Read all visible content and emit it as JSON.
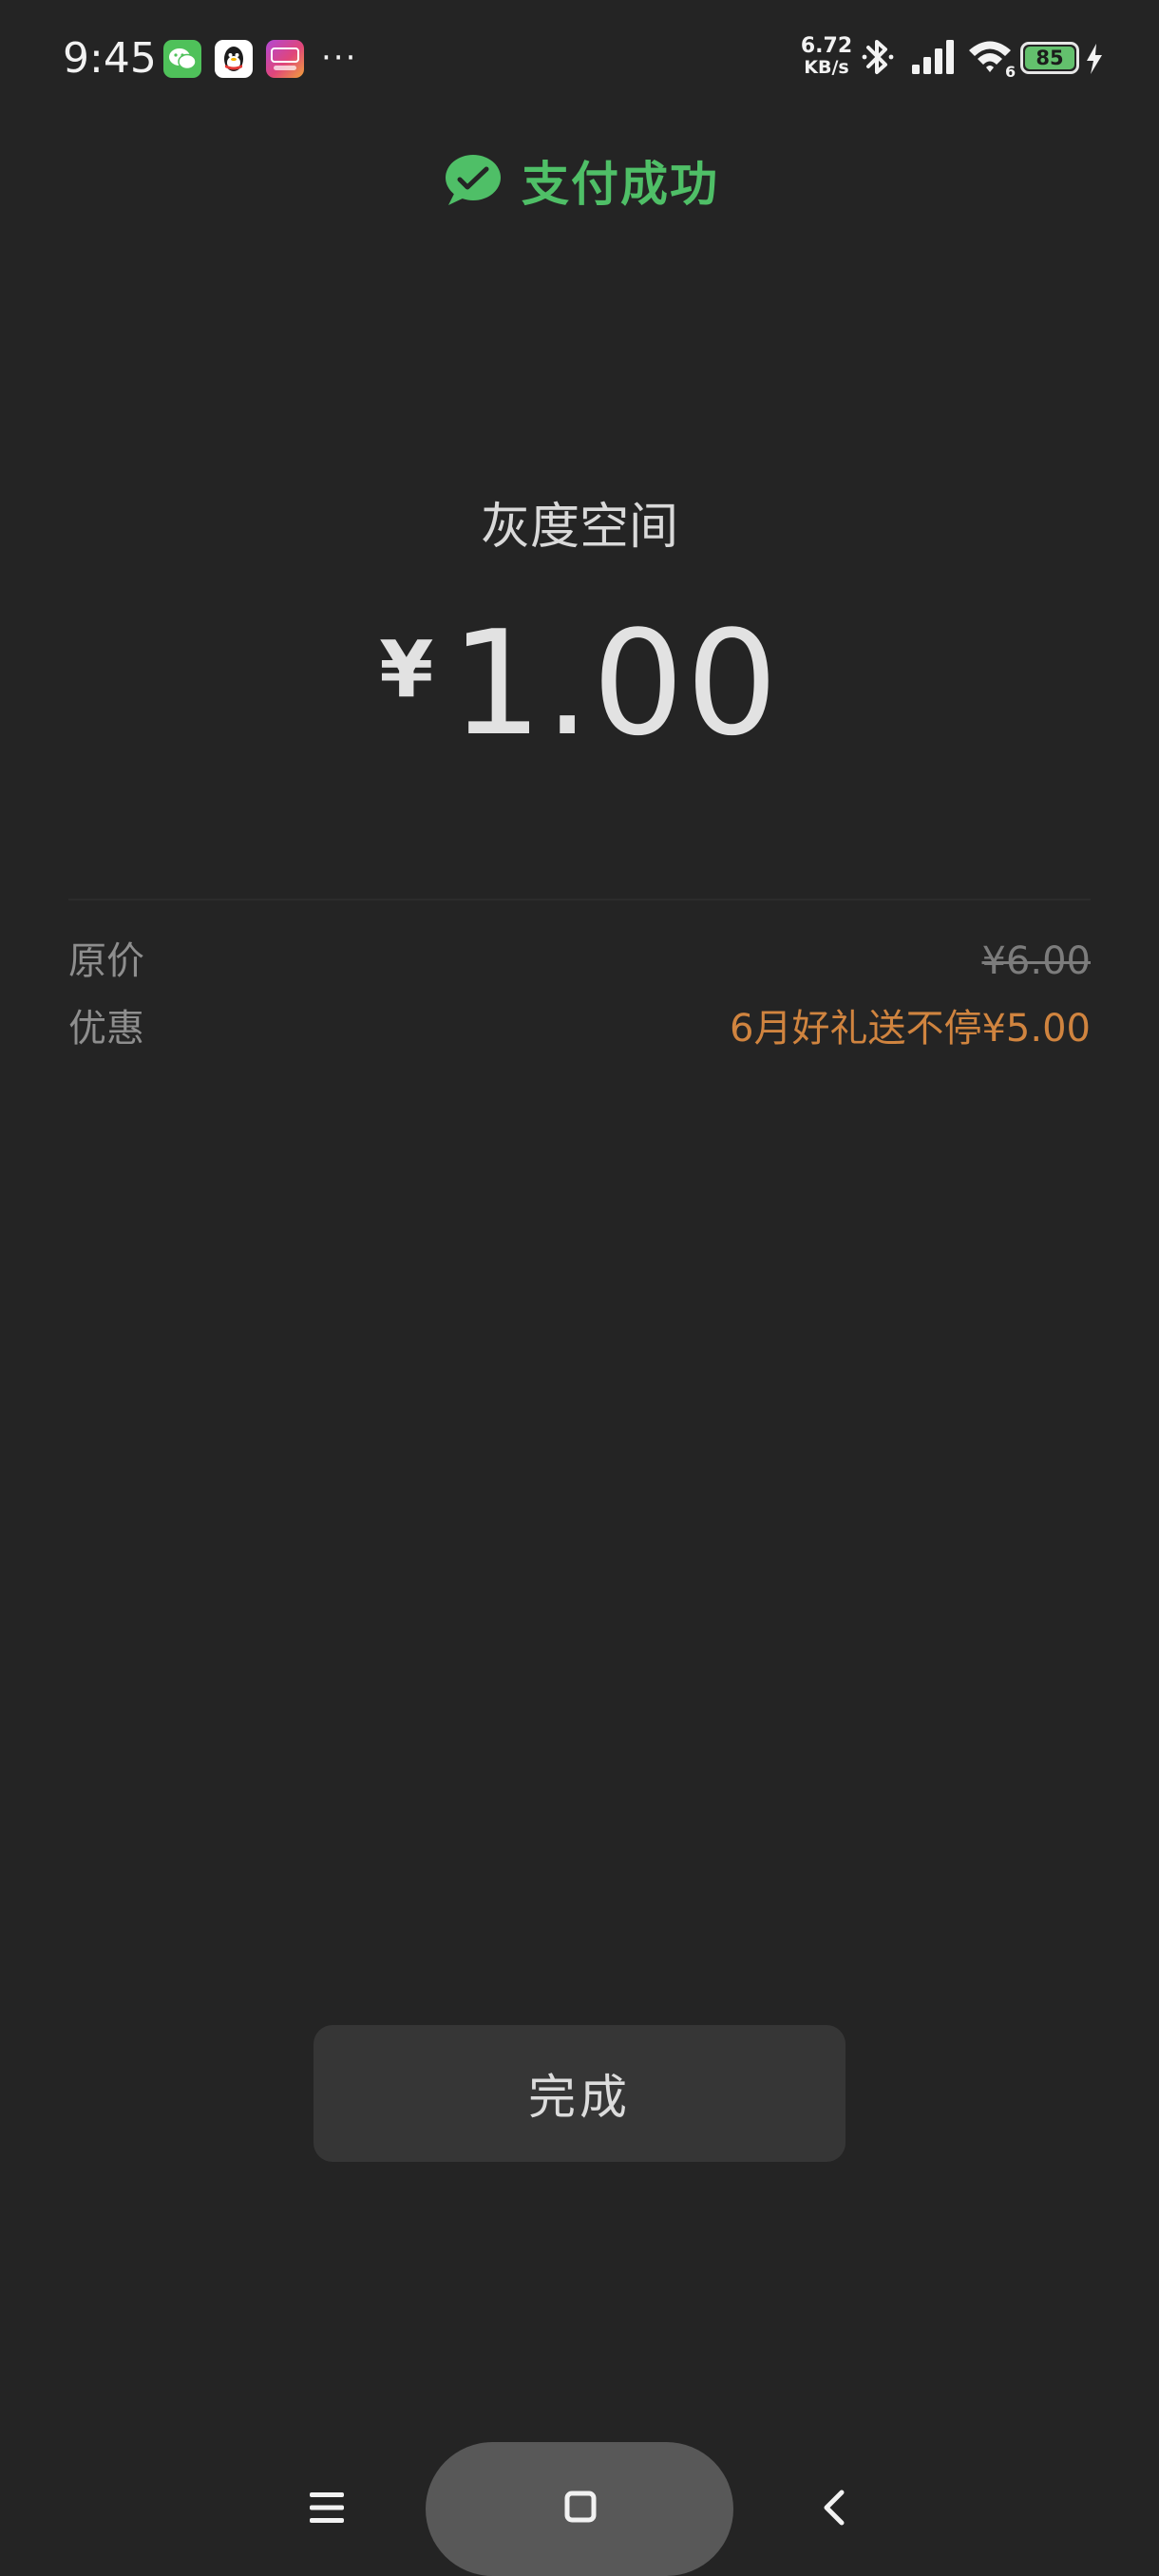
{
  "status_bar": {
    "time": "9:45",
    "net_speed_value": "6.72",
    "net_speed_unit": "KB/s",
    "more": "···",
    "wifi_label": "6",
    "battery_level": "85"
  },
  "header": {
    "title": "支付成功"
  },
  "payment": {
    "merchant": "灰度空间",
    "currency": "¥",
    "amount": "1.00"
  },
  "details": [
    {
      "label": "原价",
      "value": "¥6.00"
    },
    {
      "label": "优惠",
      "value": "6月好礼送不停¥5.00"
    }
  ],
  "actions": {
    "done_label": "完成"
  },
  "colors": {
    "background": "#242424",
    "success_green": "#4fbf67",
    "discount_orange": "#d0843f"
  }
}
